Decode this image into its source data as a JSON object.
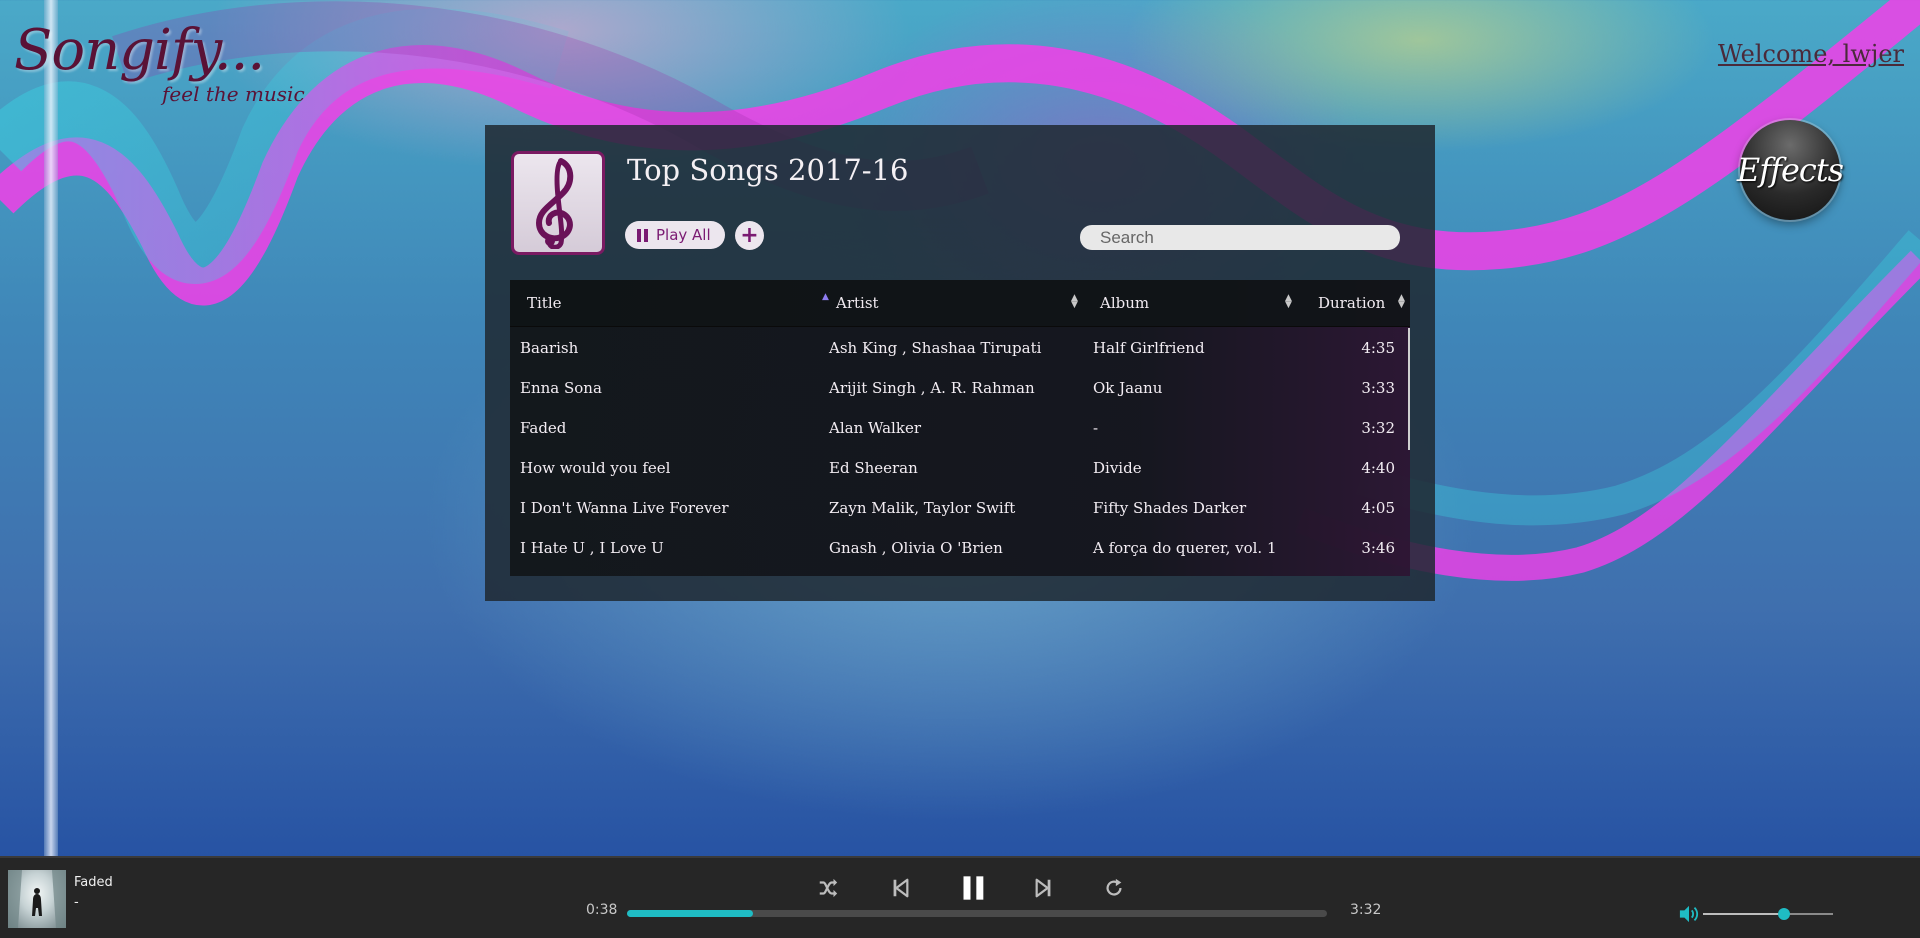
{
  "brand": {
    "logo": "Songify...",
    "tagline": "feel the music"
  },
  "header": {
    "welcome": "Welcome, lwjer",
    "effects_label": "Effects"
  },
  "playlist": {
    "title": "Top Songs 2017-16",
    "play_all_label": "Play All",
    "add_label": "+",
    "search_placeholder": "Search",
    "columns": {
      "title": "Title",
      "artist": "Artist",
      "album": "Album",
      "duration": "Duration"
    },
    "sorted_by": "title",
    "songs": [
      {
        "title": "Baarish",
        "artist": "Ash King , Shashaa Tirupati",
        "album": "Half Girlfriend",
        "duration": "4:35"
      },
      {
        "title": "Enna Sona",
        "artist": "Arijit Singh , A. R. Rahman",
        "album": "Ok Jaanu",
        "duration": "3:33"
      },
      {
        "title": "Faded",
        "artist": "Alan Walker",
        "album": "-",
        "duration": "3:32"
      },
      {
        "title": "How would you feel",
        "artist": "Ed Sheeran",
        "album": "Divide",
        "duration": "4:40"
      },
      {
        "title": "I Don't Wanna Live Forever",
        "artist": "Zayn Malik, Taylor Swift",
        "album": "Fifty Shades Darker",
        "duration": "4:05"
      },
      {
        "title": "I Hate U , I Love U",
        "artist": "Gnash , Olivia O 'Brien",
        "album": "A força do querer, vol. 1",
        "duration": "3:46"
      }
    ]
  },
  "player": {
    "now_playing_title": "Faded",
    "now_playing_artist": "-",
    "elapsed": "0:38",
    "total": "3:32",
    "progress_fraction": 0.18,
    "volume_fraction": 0.62,
    "controls": [
      "shuffle-icon",
      "previous-icon",
      "pause-icon",
      "next-icon",
      "repeat-icon"
    ],
    "accent_color": "#1fbcc4"
  },
  "colors": {
    "brand": "#5a1236",
    "playlist_accent": "#7a1a72",
    "sort_active": "#8d7cf0"
  }
}
